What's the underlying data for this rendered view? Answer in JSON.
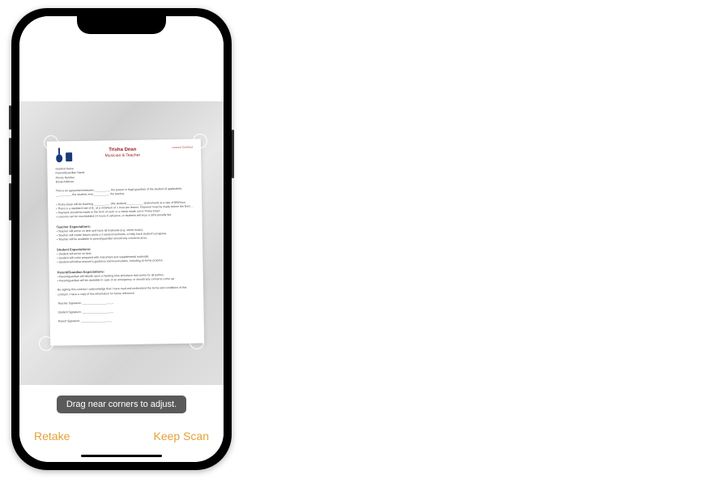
{
  "hint": "Drag near corners to adjust.",
  "buttons": {
    "retake": "Retake",
    "keep": "Keep Scan"
  },
  "document": {
    "title": "Trisha Dean",
    "subtitle": "Musician & Teacher",
    "corner": "Lesson Contract",
    "fields": {
      "f1": "Student Name",
      "f2": "Parent/Guardian Name",
      "f3": "Phone Number",
      "f4": "Email Address"
    },
    "intro": "This is an agreement between __________ the parent or legal guardian of the student (if applicable), __________ the student, and __________ the teacher.",
    "bullet1": "• Trisha Dean will be teaching __________ (the student) __________ (instrument) at a rate of $60/hour.",
    "bullet2": "• There is a standard rate of $_ at a minimum of 1 hour per lesson. Payment must be made before the first lesson.",
    "bullet3": "• Payment should be made in the form of cash or a check made out to Trisha Dean.",
    "bullet4": "• Lessons can be rescheduled 24 hours in advance, or students will incur a 50% penalty fee.",
    "sec1": "Teacher Expectations:",
    "sec1a": "• Teacher will arrive on time and have all materials (e.g. sheet music).",
    "sec1b": "• Teacher will create lesson plans a 2-week increments, to help track student's progress.",
    "sec1c": "• Teacher will be available to parent/guardian should any concerns arise.",
    "sec2": "Student Expectations:",
    "sec2a": "• Student will arrive on time.",
    "sec2b": "• Student will come prepared with instrument and supplemental materials.",
    "sec2c": "• Student will follow teacher's guidance and lesson plans, including at-home practice.",
    "sec3": "Parent/Guardian Expectations:",
    "sec3a": "• Parent/guardian will decide upon a meeting time and place that works for all parties.",
    "sec3b": "• Parent/guardian will be available in case of an emergency, or should any concerns come up.",
    "closing": "By signing this contract I acknowledge that I have read and understand the terms and conditions of this contract. I have a copy of this information for future reference.",
    "sig1": "Teacher Signature: ____________________",
    "sig2": "Student Signature: ____________________",
    "sig3": "Parent Signature: ____________________"
  }
}
